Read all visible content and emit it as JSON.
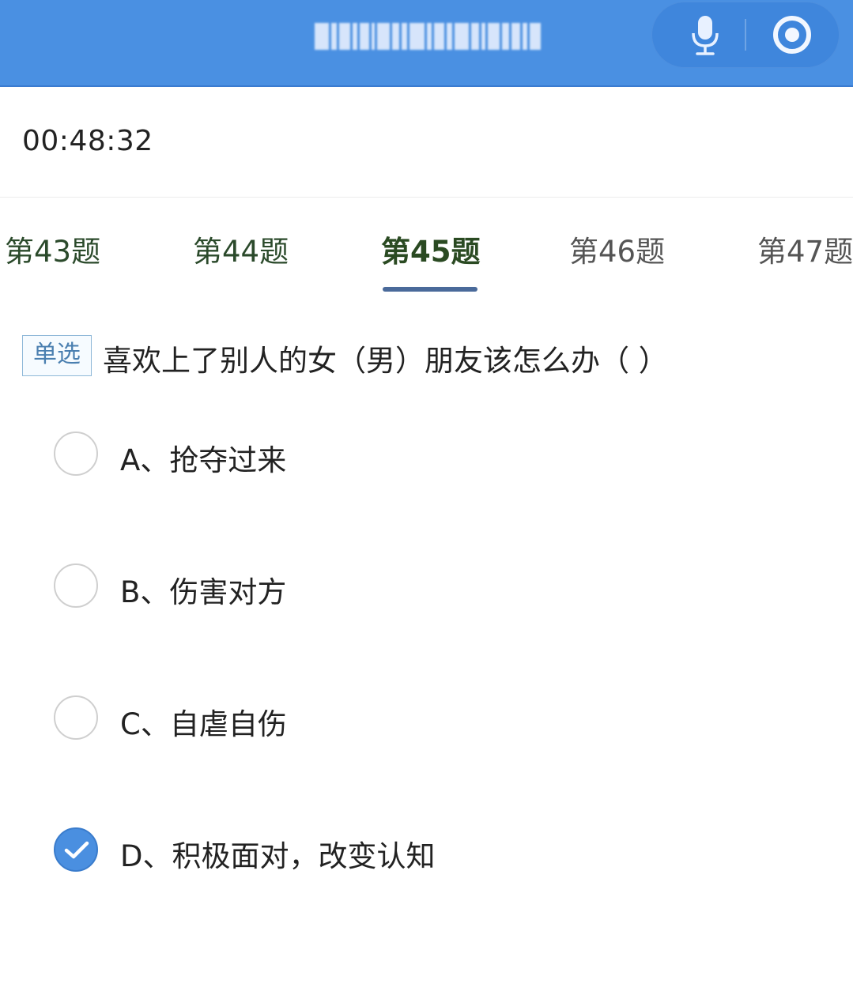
{
  "header": {
    "mic_icon": "microphone-icon",
    "target_icon": "record-target-icon",
    "colors": {
      "bar": "#4a90e2",
      "pill": "#3f86dc"
    }
  },
  "timer": "00:48:32",
  "tabs": [
    {
      "label": "第43题",
      "state": "normal"
    },
    {
      "label": "第44题",
      "state": "normal"
    },
    {
      "label": "第45题",
      "state": "active"
    },
    {
      "label": "第46题",
      "state": "normal"
    },
    {
      "label": "第47题",
      "state": "normal"
    }
  ],
  "question": {
    "type_tag": "单选",
    "text": "喜欢上了别人的女（男）朋友该怎么办（ ）"
  },
  "options": [
    {
      "label": "A、抢夺过来",
      "checked": false
    },
    {
      "label": "B、伤害对方",
      "checked": false
    },
    {
      "label": "C、自虐自伤",
      "checked": false
    },
    {
      "label": "D、积极面对，改变认知",
      "checked": true
    }
  ]
}
